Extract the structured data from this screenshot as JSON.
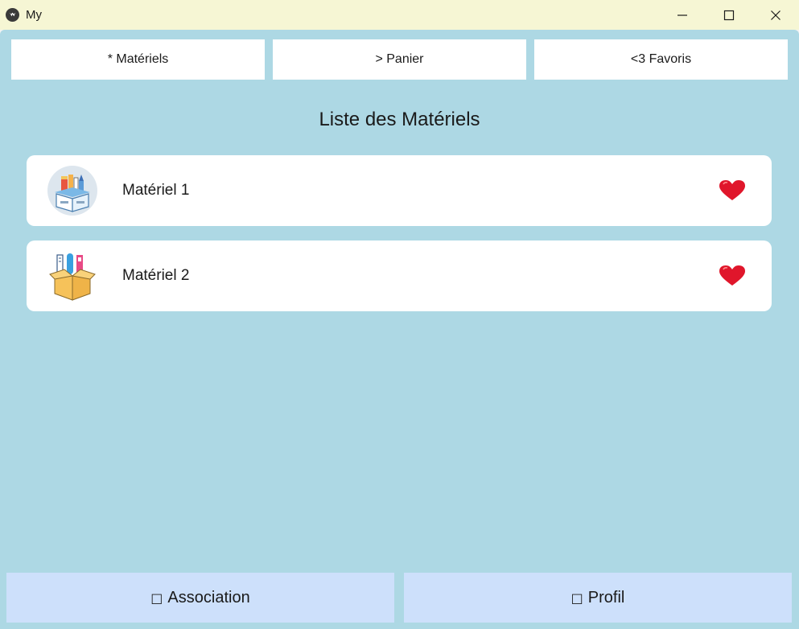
{
  "window": {
    "title": "My",
    "icons": {
      "app": "kivy-logo-icon",
      "minimize": "minimize-icon",
      "maximize": "maximize-icon",
      "close": "close-icon"
    }
  },
  "nav": {
    "tabs": [
      {
        "label": "* Matériels"
      },
      {
        "label": "> Panier"
      },
      {
        "label": "<3 Favoris"
      }
    ]
  },
  "list": {
    "title": "Liste des Matériels",
    "items": [
      {
        "name": "Matériel 1",
        "image": "school-supplies-box-icon",
        "favorite_icon": "heart-icon"
      },
      {
        "name": "Matériel 2",
        "image": "open-box-supplies-icon",
        "favorite_icon": "heart-icon"
      }
    ]
  },
  "bottom_nav": {
    "buttons": [
      {
        "glyph": "□",
        "label": "Association"
      },
      {
        "glyph": "□",
        "label": "Profil"
      }
    ]
  },
  "colors": {
    "background": "#add8e4",
    "titlebar": "#f6f6d4",
    "card": "#ffffff",
    "bottom_button": "#cde0fb",
    "heart": "#e0162b"
  }
}
